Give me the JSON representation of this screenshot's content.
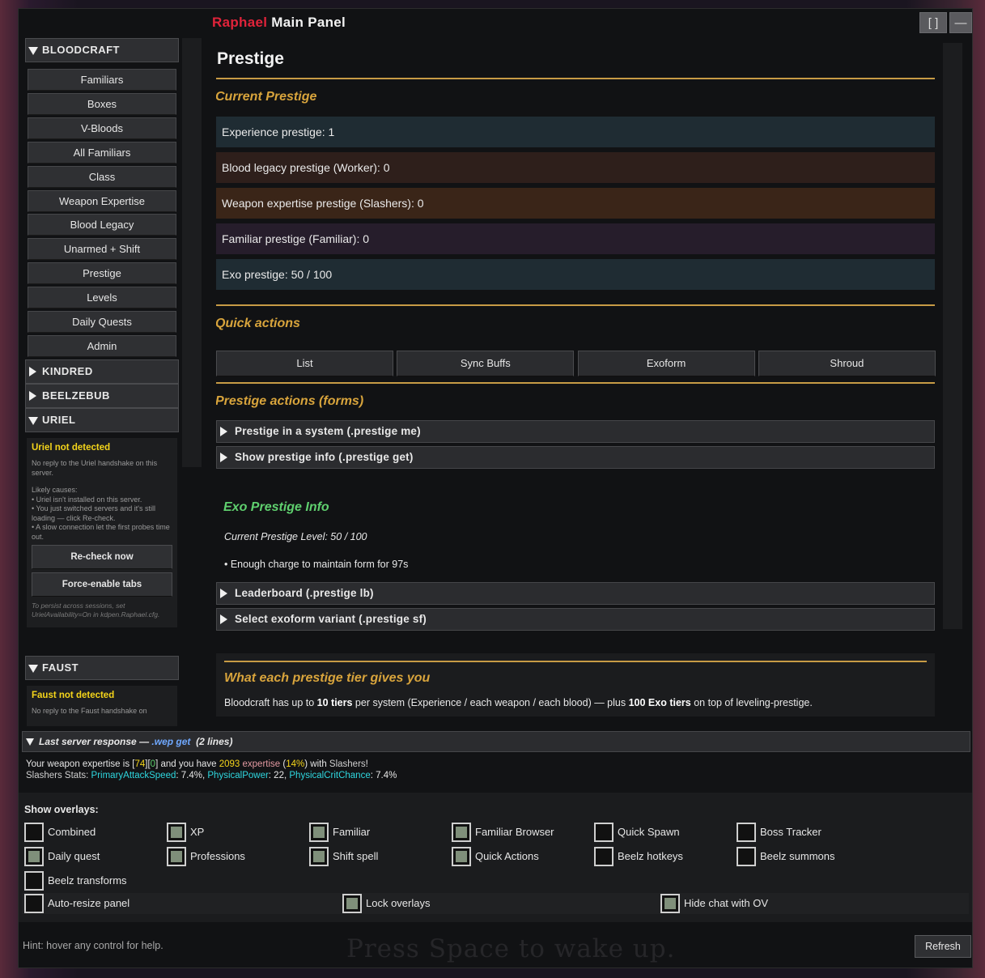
{
  "window": {
    "title_brand": "Raphael",
    "title_rest": "Main Panel",
    "maximize_label": "[ ]",
    "minimize_label": "—"
  },
  "sidebar": {
    "bloodcraft": {
      "label": "BLOODCRAFT",
      "items": [
        "Familiars",
        "Boxes",
        "V-Bloods",
        "All Familiars",
        "Class",
        "Weapon Expertise",
        "Blood Legacy",
        "Unarmed + Shift",
        "Prestige",
        "Levels",
        "Daily Quests",
        "Admin"
      ]
    },
    "kindred": "KINDRED",
    "beelzebub": "BEELZEBUB",
    "uriel": {
      "label": "URIEL",
      "status_title": "Uriel not detected",
      "status_desc": "No reply to the Uriel handshake on this server.",
      "causes_title": "Likely causes:",
      "cause_1": "• Uriel isn't installed on this server.",
      "cause_2": "• You just switched servers and it's still loading — click Re-check.",
      "cause_3": "• A slow connection let the first probes time out.",
      "recheck_label": "Re-check now",
      "force_label": "Force-enable tabs",
      "persist_note": "To persist across sessions, set UrielAvailability=On in kdpen.Raphael.cfg."
    },
    "faust": {
      "label": "FAUST",
      "status_title": "Faust not detected",
      "status_desc": "No reply to the Faust handshake on"
    }
  },
  "main": {
    "page_title": "Prestige",
    "current_heading": "Current Prestige",
    "stats": [
      {
        "text": "Experience prestige: 1",
        "color": "#1f2c33"
      },
      {
        "text": "Blood legacy prestige (Worker): 0",
        "color": "#2e1f1b"
      },
      {
        "text": "Weapon expertise prestige (Slashers): 0",
        "color": "#3a2518"
      },
      {
        "text": "Familiar prestige (Familiar): 0",
        "color": "#261d2b"
      },
      {
        "text": "Exo prestige: 50 / 100",
        "color": "#1f2c33"
      }
    ],
    "quick_heading": "Quick actions",
    "quick_actions": [
      "List",
      "Sync Buffs",
      "Exoform",
      "Shroud"
    ],
    "forms_heading": "Prestige actions (forms)",
    "fold_prestige_me": "Prestige in a system (.prestige me)",
    "fold_prestige_get": "Show prestige info (.prestige get)",
    "exo_title": "Exo Prestige Info",
    "exo_level": "Current Prestige Level: 50 / 100",
    "exo_charge": "• Enough charge to maintain form for 97s",
    "fold_lb": "Leaderboard (.prestige lb)",
    "fold_sf": "Select exoform variant (.prestige sf)",
    "tier_title": "What each prestige tier gives you",
    "tier_text_1": "Bloodcraft has up to ",
    "tier_text_b1": "10 tiers",
    "tier_text_2": " per system (Experience / each weapon / each blood) — plus ",
    "tier_text_b2": "100 Exo tiers",
    "tier_text_3": " on top of leveling-prestige."
  },
  "response": {
    "header_prefix": "Last server response — ",
    "command": ".wep get",
    "line_count": "(2 lines)",
    "l1_a": "Your weapon expertise is [",
    "l1_lvl": "74",
    "l1_b": "][",
    "l1_pre": "0",
    "l1_c": "] and you have ",
    "l1_xp": "2093",
    "l1_d": " expertise",
    "l1_e": " (",
    "l1_pct": "14%",
    "l1_f": ") with ",
    "l1_wep": "Slashers",
    "l1_g": "!",
    "l2_a": "Slashers Stats: ",
    "l2_s1": "PrimaryAttackSpeed",
    "l2_v1": ": 7.4%, ",
    "l2_s2": "PhysicalPower",
    "l2_v2": ": 22, ",
    "l2_s3": "PhysicalCritChance",
    "l2_v3": ": 7.4%"
  },
  "overlays": {
    "label": "Show overlays:",
    "items": [
      {
        "label": "Combined",
        "checked": false
      },
      {
        "label": "XP",
        "checked": true
      },
      {
        "label": "Familiar",
        "checked": true
      },
      {
        "label": "Familiar Browser",
        "checked": true
      },
      {
        "label": "Quick Spawn",
        "checked": false
      },
      {
        "label": "Boss Tracker",
        "checked": false
      },
      {
        "label": "Daily quest",
        "checked": true
      },
      {
        "label": "Professions",
        "checked": true
      },
      {
        "label": "Shift spell",
        "checked": true
      },
      {
        "label": "Quick Actions",
        "checked": true
      },
      {
        "label": "Beelz hotkeys",
        "checked": false
      },
      {
        "label": "Beelz summons",
        "checked": false
      },
      {
        "label": "Beelz transforms",
        "checked": false
      }
    ],
    "auto_resize": {
      "label": "Auto-resize panel",
      "checked": false
    },
    "lock": {
      "label": "Lock overlays",
      "checked": true
    },
    "hide_chat": {
      "label": "Hide chat with OV",
      "checked": true
    }
  },
  "footer": {
    "hint": "Hint: hover any control for help.",
    "refresh_label": "Refresh",
    "wake_text": "Press Space to wake up."
  }
}
